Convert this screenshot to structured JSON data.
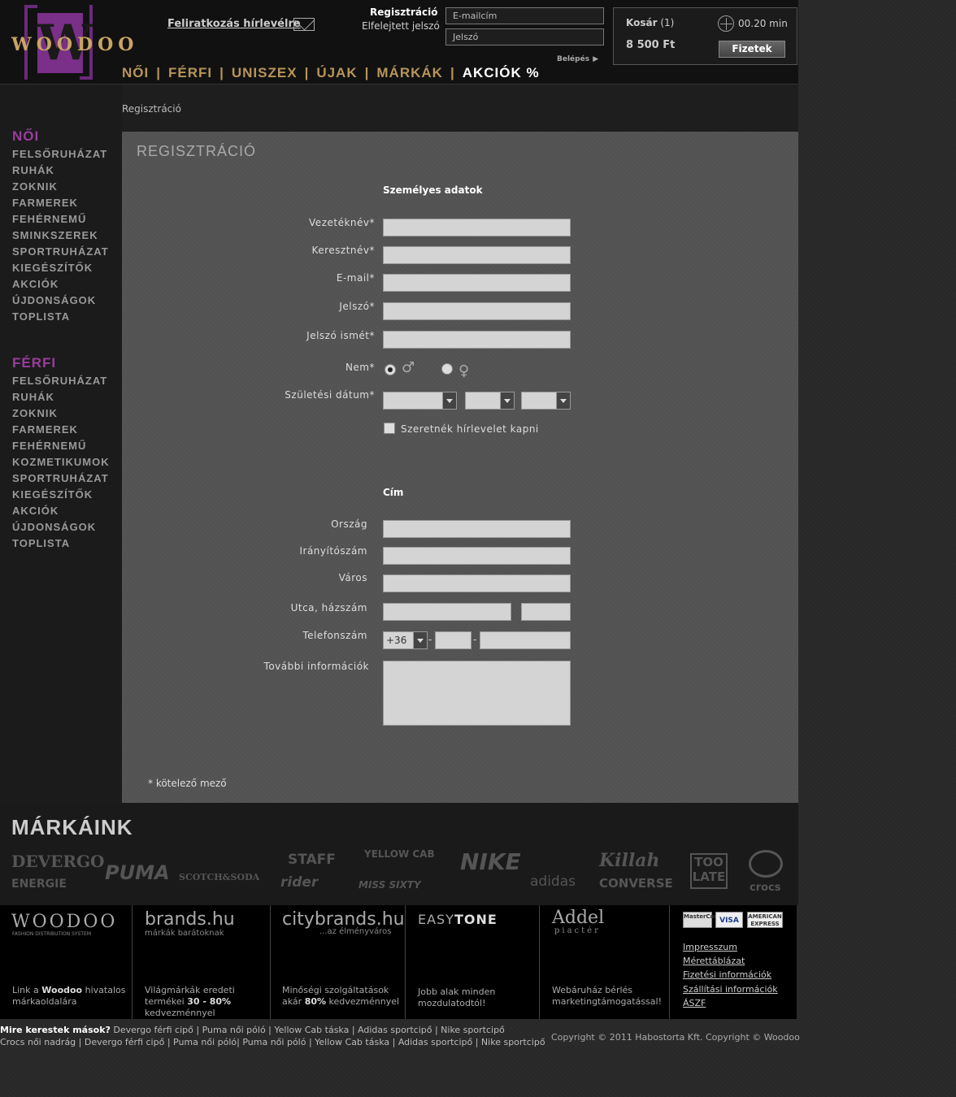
{
  "header": {
    "logo_text": "WOODOO",
    "logo_letter": "W",
    "newsletter_label": "Feliratkozás hírlevélre",
    "register_label": "Regisztráció",
    "forgot_password_label": "Elfelejtett jelszó",
    "email_placeholder": "E-mailcím",
    "password_placeholder": "Jelszó",
    "login_label": "Belépés",
    "cart": {
      "title": "Kosár",
      "count": "(1)",
      "price": "8 500 Ft",
      "time": "00.20 min",
      "pay_label": "Fizetek"
    },
    "nav": [
      {
        "label": "NŐI"
      },
      {
        "label": "FÉRFI"
      },
      {
        "label": "UNISZEX"
      },
      {
        "label": "ÚJAK"
      },
      {
        "label": "MÁRKÁK"
      },
      {
        "label": "AKCIÓK %"
      }
    ],
    "nav_separator": "|"
  },
  "sidebar": {
    "women": {
      "title": "NŐI",
      "items": [
        "FELSŐRUHÁZAT",
        "RUHÁK",
        "ZOKNIK",
        "FARMEREK",
        "FEHÉRNEMŰ",
        "SMINKSZEREK",
        "SPORTRUHÁZAT",
        "KIEGÉSZÍTŐK",
        "AKCIÓK",
        "ÚJDONSÁGOK",
        "TOPLISTA"
      ]
    },
    "men": {
      "title": "FÉRFI",
      "items": [
        "FELSŐRUHÁZAT",
        "RUHÁK",
        "ZOKNIK",
        "FARMEREK",
        "FEHÉRNEMŰ",
        "KOZMETIKUMOK",
        "SPORTRUHÁZAT",
        "KIEGÉSZÍTŐK",
        "AKCIÓK",
        "ÚJDONSÁGOK",
        "TOPLISTA"
      ]
    }
  },
  "breadcrumb": "Regisztráció",
  "form": {
    "title": "REGISZTRÁCIÓ",
    "personal_heading": "Személyes adatok",
    "fields": {
      "lastname": "Vezetéknév*",
      "firstname": "Keresztnév*",
      "email": "E-mail*",
      "password": "Jelszó*",
      "password_repeat": "Jelszó ismét*",
      "gender": "Nem*",
      "birthdate": "Születési dátum*"
    },
    "gender_male_icon": "♂",
    "gender_female_icon": "♀",
    "newsletter_checkbox": "Szeretnék hírlevelet kapni",
    "address_heading": "Cím",
    "address_fields": {
      "country": "Ország",
      "zip": "Irányítószám",
      "city": "Város",
      "street": "Utca, házszám",
      "phone": "Telefonszám",
      "extra": "További információk"
    },
    "phone_prefix": "+36",
    "phone_dash": "-",
    "required_note": "* kötelező mező"
  },
  "brands": {
    "title": "MÁRKÁINK",
    "logos": [
      "DEVERGO",
      "ENERGIE",
      "PUMA",
      "SCOTCH&SODA",
      "STAFF",
      "rider",
      "YELLOW CAB",
      "MISS SIXTY",
      "NIKE",
      "adidas",
      "Killah",
      "CONVERSE",
      "TOO LATE",
      "crocs"
    ]
  },
  "footer": {
    "woodoo": {
      "title": "WOODOO",
      "sub": "FASHION DISTRIBUTION SYSTEM",
      "desc_pre": "Link a ",
      "desc_bold": "Woodoo",
      "desc_post": " hivatalos márkaoldalára"
    },
    "brandshu": {
      "title": "brands.hu",
      "sub": "márkák barátoknak",
      "desc_pre": "Világmárkák eredeti termékei ",
      "desc_bold": "30 - 80%",
      "desc_post": " kedvezménnyel"
    },
    "citybrands": {
      "title": "citybrands.hu",
      "sub": "...az élményváros",
      "desc_pre": "Minőségi szolgáltatások akár ",
      "desc_bold": "80%",
      "desc_post": " kedvezménnyel"
    },
    "easytone": {
      "title_a": "EASY",
      "title_b": "TONE",
      "desc": "Jobb alak minden mozdulatodtól!"
    },
    "addel": {
      "title": "Addel",
      "sub": "piactér",
      "desc": "Webáruház bérlés marketingtámogatással!"
    },
    "cards": [
      "MasterCard",
      "VISA",
      "AMERICAN EXPRESS"
    ],
    "links": [
      "Impresszum",
      "Mérettáblázat",
      "Fizetési információk",
      "Szállítási információk",
      "ÁSZF"
    ]
  },
  "bottom": {
    "search_label": "Mire kerestek mások?",
    "line1": "Devergo férfi cipő | Puma női póló | Yellow Cab táska | Adidas sportcipő | Nike sportcipő",
    "line2": "Crocs női nadrág | Devergo férfi cipő | Puma női póló| Puma női póló | Yellow Cab táska | Adidas sportcipő | Nike sportcipő",
    "copyright": "Copyright © 2011 Habostorta Kft.    Copyright © Woodoo"
  }
}
